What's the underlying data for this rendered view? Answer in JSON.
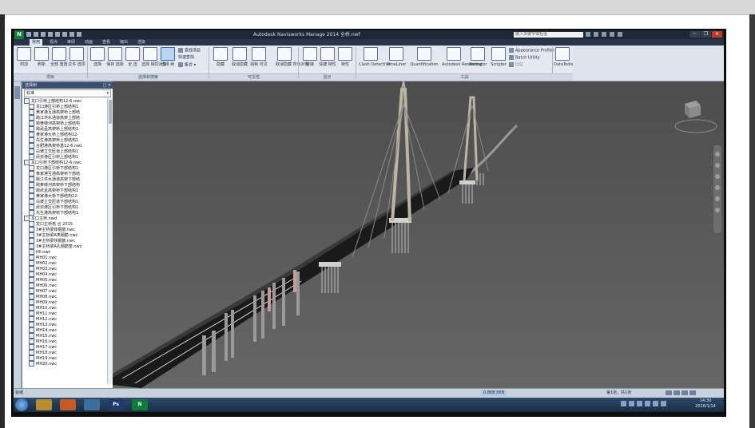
{
  "window": {
    "app_logo": "N",
    "title": "Autodesk Navisworks Manage 2014  全桥.nwf",
    "search_placeholder": "键入关键字或短语",
    "minimize": "─",
    "restore": "❐",
    "close": "✕"
  },
  "menu_tabs": [
    {
      "label": "常用",
      "active": true
    },
    {
      "label": "视点"
    },
    {
      "label": "审阅"
    },
    {
      "label": "动画"
    },
    {
      "label": "查看"
    },
    {
      "label": "输出"
    },
    {
      "label": "渲染"
    }
  ],
  "ribbon": {
    "home": {
      "append": "附加",
      "refresh": "刷新",
      "reset_all": "全部\n重置...",
      "file_options": "文件\n选项",
      "select": "选择",
      "save_selection": "保存\n选择",
      "select_all": "全\n选",
      "select_same": "选择\n相同对象",
      "selection_tree": "选择\n树",
      "find_items": "查找项目",
      "quick_find": "快速查找",
      "sets": "集合",
      "hide": "隐藏",
      "hide_unselected": "取消隐藏",
      "require": "强制\n可见",
      "unhide_all": "取消隐藏\n所有对象",
      "links": "链接",
      "quick_properties": "快捷\n特性",
      "properties": "特性",
      "clash_detective": "Clash\nDetective",
      "timeliner": "TimeLiner",
      "quantification": "Quantification",
      "autodesk_rendering": "Autodesk\nRendering",
      "animator": "Animator",
      "scripter": "Scripter",
      "appearance_profiler": "Appearance Profiler",
      "batch_utility": "Batch Utility",
      "compare": "比较",
      "datatools": "DataTools"
    },
    "groups": {
      "project": "项目",
      "select_search": "选择和搜索",
      "visibility": "可见性",
      "display": "显示",
      "tools": "工具"
    }
  },
  "selection_tree": {
    "title": "选择树",
    "controls": "□ ✕",
    "mode": "标准",
    "items": [
      "龙口引桥上部结构12-6.nwc",
      "龙口港区引桥上部结构1",
      "黄家港互通高架桥上部结",
      "跨江洪水通道高架上部结",
      "跨黄墩河高架桥上部结构",
      "跨武孟高架桥上部结构1",
      "黄家港大桥上部结构12-",
      "先生港高架桥上部结构1",
      "合肥港高架桥基12-6.nwc",
      "白坡立交匝道上部结构1",
      "武崇港区引桥上部结构1",
      "龙口引桥下部结构12-6.nwc",
      "龙口港区引桥下部结构1",
      "黄家港互通高架桥下部结",
      "跨江洪水通道高架下部结",
      "跨黄墩河高架桥下部结构",
      "跨武孟高架桥下部结构1",
      "黄家港大桥下部结构12-",
      "白坡立交匝道下部结构1",
      "武崇港区引桥下部结构1",
      "先生港高架桥下部结构1",
      "龙口主桥.nwd",
      "龙口主桥塔  合    2015",
      "3#主桥梁体钢筋.nwc",
      "3#主桥梁A类钢筋.nwc",
      "3#主桥梁块钢筋.nwc",
      "3#主桥梁A孔钢筋笼.nwc",
      "HII.nwc",
      "MH01.nwc",
      "MH02.nwc",
      "MH03.nwc",
      "MH04.nwc",
      "MH05.nwc",
      "MH06.nwc",
      "MH07.nwc",
      "MH08.nwc",
      "MH09.nwc",
      "MH10.nwc",
      "MH11.nwc",
      "MH12.nwc",
      "MH13.nwc",
      "MH14.nwc",
      "MH15.nwc",
      "MH16.nwc",
      "MH17.nwc",
      "MH18.nwc",
      "MH19.nwc",
      "MH20.nwc"
    ]
  },
  "status_bar": {
    "ready": "就绪",
    "stats": "0.8KB  0KB",
    "page": "第1张，共1张"
  },
  "taskbar": {
    "apps": [
      "",
      "",
      "",
      "Ps",
      "N"
    ],
    "time": "14:30",
    "date": "2016/1/14"
  }
}
